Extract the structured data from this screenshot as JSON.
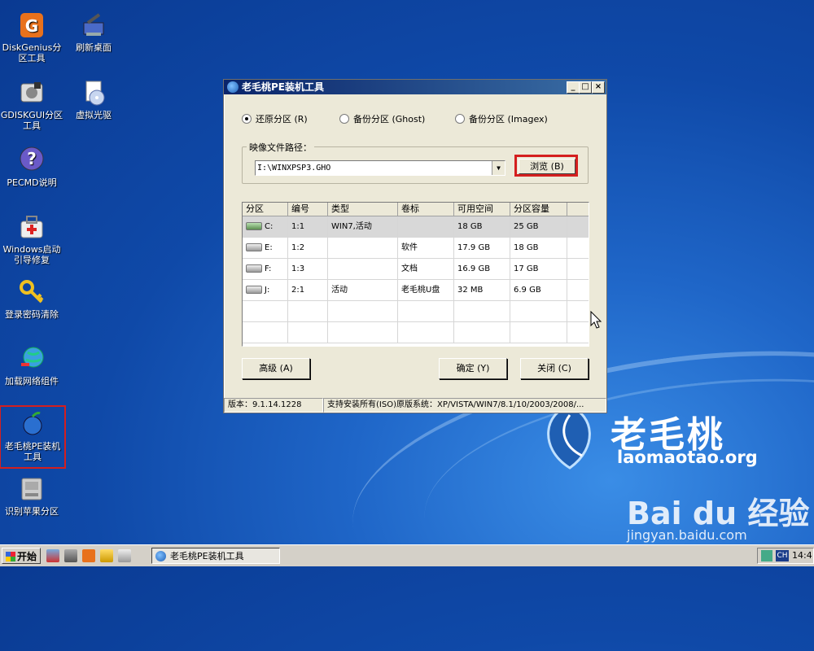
{
  "desktop": {
    "icons": [
      {
        "label": "DiskGenius分区工具",
        "icon": "diskgenius-icon"
      },
      {
        "label": "刷新桌面",
        "icon": "refresh-desktop-icon"
      },
      {
        "label": "GDISKGUI分区工具",
        "icon": "gdiskgui-icon"
      },
      {
        "label": "虚拟光驱",
        "icon": "virtual-drive-icon"
      },
      {
        "label": "PECMD说明",
        "icon": "help-icon"
      },
      {
        "label": "Windows启动引导修复",
        "icon": "boot-repair-icon"
      },
      {
        "label": "登录密码清除",
        "icon": "key-icon"
      },
      {
        "label": "加载网络组件",
        "icon": "network-globe-icon"
      },
      {
        "label": "老毛桃PE装机工具",
        "icon": "peach-app-icon"
      },
      {
        "label": "识别苹果分区",
        "icon": "apple-partition-icon"
      }
    ],
    "brand": {
      "name": "老毛桃",
      "url": "laomaotao.org",
      "watermark_logo": "Bai du 经验",
      "watermark_url": "jingyan.baidu.com"
    }
  },
  "window": {
    "title": "老毛桃PE装机工具",
    "title_buttons": [
      "_",
      "□",
      "×"
    ],
    "modes": [
      {
        "label": "还原分区 (R)",
        "selected": true
      },
      {
        "label": "备份分区 (Ghost)",
        "selected": false
      },
      {
        "label": "备份分区 (Imagex)",
        "selected": false
      }
    ],
    "image_path_label": "映像文件路径：",
    "image_path_value": "I:\\WINXPSP3.GHO",
    "browse_label": "浏览 (B)",
    "columns": [
      "分区",
      "编号",
      "类型",
      "卷标",
      "可用空间",
      "分区容量"
    ],
    "rows": [
      {
        "partition": "C:",
        "number": "1:1",
        "type": "WIN7,活动",
        "label": "",
        "free": "18 GB",
        "capacity": "25 GB"
      },
      {
        "partition": "E:",
        "number": "1:2",
        "type": "",
        "label": "软件",
        "free": "17.9 GB",
        "capacity": "18 GB"
      },
      {
        "partition": "F:",
        "number": "1:3",
        "type": "",
        "label": "文档",
        "free": "16.9 GB",
        "capacity": "17 GB"
      },
      {
        "partition": "J:",
        "number": "2:1",
        "type": "活动",
        "label": "老毛桃U盘",
        "free": "32 MB",
        "capacity": "6.9 GB"
      }
    ],
    "advanced_label": "高级 (A)",
    "ok_label": "确定 (Y)",
    "close_label": "关闭 (C)",
    "status_version": "版本：9.1.14.1228",
    "status_support": "支持安装所有(ISO)原版系统：XP/VISTA/WIN7/8.1/10/2003/2008/..."
  },
  "taskbar": {
    "start_label": "开始",
    "task_label": "老毛桃PE装机工具",
    "lang": "CH",
    "clock": "14:4"
  }
}
